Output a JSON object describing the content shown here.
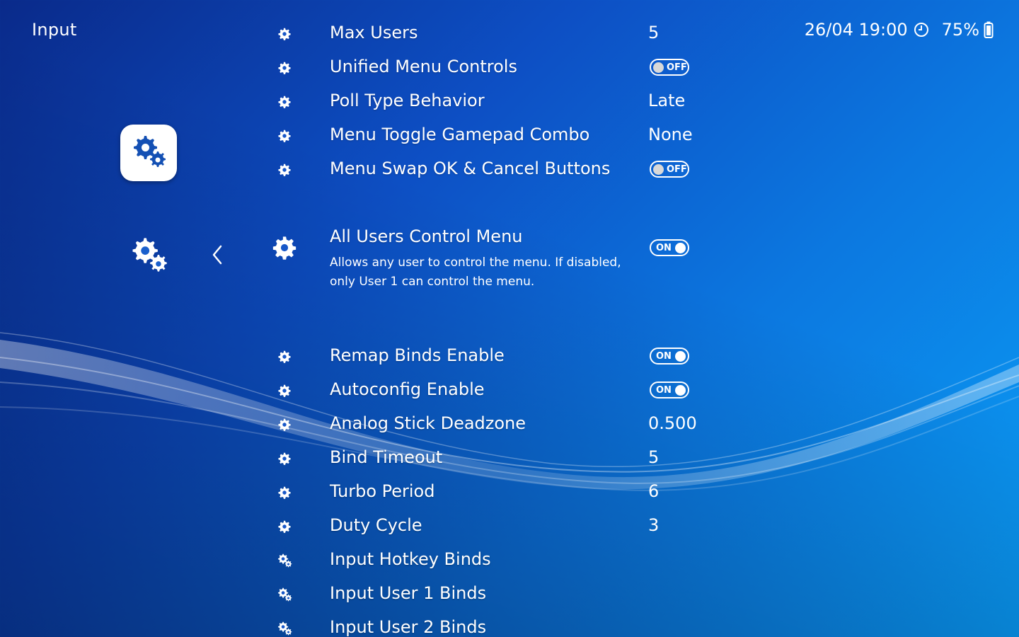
{
  "header": {
    "menu_title": "Input",
    "datetime": "26/04 19:00",
    "battery_percent": "75%",
    "clock_icon": "clock-icon",
    "battery_icon": "battery-icon"
  },
  "sidebar": {
    "selected_tab_icon": "settings-gears-icon",
    "parent_tab_icon": "settings-gears-icon",
    "back_icon": "chevron-left-icon"
  },
  "entries": [
    {
      "label": "Max Users",
      "value": "5",
      "type": "value",
      "icon": "gear-icon"
    },
    {
      "label": "Unified Menu Controls",
      "value": "OFF",
      "type": "toggle-off",
      "icon": "gear-icon"
    },
    {
      "label": "Poll Type Behavior",
      "value": "Late",
      "type": "value",
      "icon": "gear-icon"
    },
    {
      "label": "Menu Toggle Gamepad Combo",
      "value": "None",
      "type": "value",
      "icon": "gear-icon"
    },
    {
      "label": "Menu Swap OK & Cancel Buttons",
      "value": "OFF",
      "type": "toggle-off",
      "icon": "gear-icon"
    },
    {
      "label": "All Users Control Menu",
      "value": "ON",
      "type": "toggle-on",
      "icon": "gear-icon",
      "selected": true,
      "description_line1": "Allows any user to control the menu. If disabled,",
      "description_line2": "only User 1 can control the menu."
    },
    {
      "label": "Remap Binds Enable",
      "value": "ON",
      "type": "toggle-on",
      "icon": "gear-icon"
    },
    {
      "label": "Autoconfig Enable",
      "value": "ON",
      "type": "toggle-on",
      "icon": "gear-icon"
    },
    {
      "label": "Analog Stick Deadzone",
      "value": "0.500",
      "type": "value",
      "icon": "gear-icon"
    },
    {
      "label": "Bind Timeout",
      "value": "5",
      "type": "value",
      "icon": "gear-icon"
    },
    {
      "label": "Turbo Period",
      "value": "6",
      "type": "value",
      "icon": "gear-icon"
    },
    {
      "label": "Duty Cycle",
      "value": "3",
      "type": "value",
      "icon": "gear-icon"
    },
    {
      "label": "Input Hotkey Binds",
      "value": "",
      "type": "submenu",
      "icon": "gears-icon"
    },
    {
      "label": "Input User 1 Binds",
      "value": "",
      "type": "submenu",
      "icon": "gears-icon"
    },
    {
      "label": "Input User 2 Binds",
      "value": "",
      "type": "submenu",
      "icon": "gears-icon"
    }
  ]
}
